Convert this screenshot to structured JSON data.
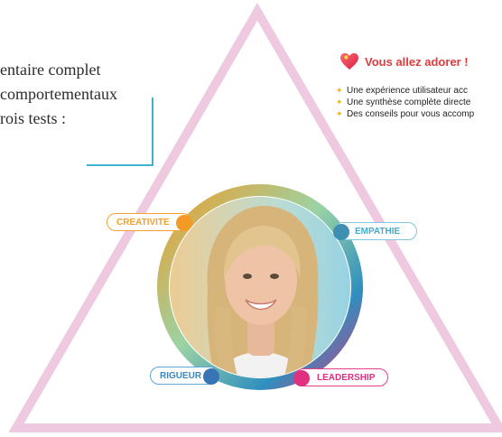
{
  "intro": {
    "lines": [
      "entaire complet",
      "comportementaux",
      "rois tests :"
    ]
  },
  "benefits": {
    "title": "Vous allez adorer !",
    "items": [
      "Une expérience utilisateur acc",
      "Une synthèse complète directe",
      "Des conseils pour vous accomp"
    ]
  },
  "traits": {
    "creativite": "CREATIVITE",
    "empathie": "EMPATHIE",
    "rigueur": "RIGUEUR",
    "leadership": "LEADERSHIP"
  },
  "colors": {
    "triangle": "#efc9df",
    "accent_blue": "#3fb2d0",
    "heart_red": "#e23a3a",
    "orange": "#f39a26",
    "pink": "#e0307f"
  },
  "icons": {
    "heart": "heart-icon",
    "sparkle": "sparkle-icon"
  },
  "portrait": {
    "description_icon": "person-portrait"
  }
}
